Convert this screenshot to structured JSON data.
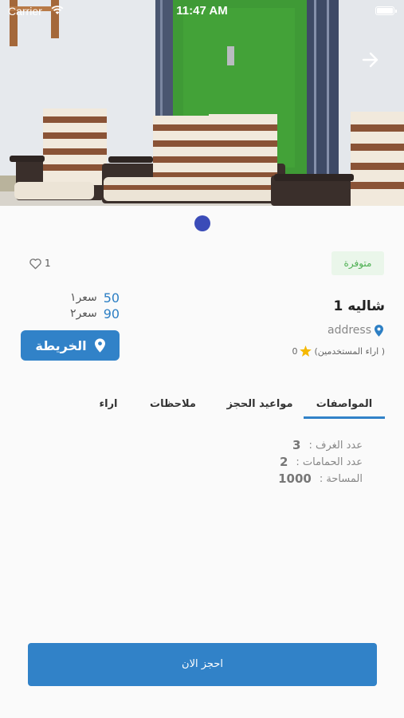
{
  "status_bar": {
    "carrier": "Carrier",
    "time": "11:47 AM"
  },
  "hero": {
    "page_count": 1,
    "current_page": 1
  },
  "listing": {
    "availability": "متوفرة",
    "favorites_count": "1",
    "title": "شاليه 1",
    "address": "address",
    "rating_value": "0",
    "reviews_label": "(اراء المستخدمين )",
    "prices": [
      {
        "label": "سعر١",
        "value": "50"
      },
      {
        "label": "سعر٢",
        "value": "90"
      }
    ],
    "map_button": "الخريطة"
  },
  "tabs": [
    {
      "label": "المواصفات",
      "active": true
    },
    {
      "label": "مواعيد الحجز",
      "active": false
    },
    {
      "label": "ملاحظات",
      "active": false
    },
    {
      "label": "اراء",
      "active": false
    }
  ],
  "specs": [
    {
      "label": "عدد الغرف :",
      "value": "3"
    },
    {
      "label": "عدد الحمامات :",
      "value": "2"
    },
    {
      "label": "المساحة :",
      "value": "1000"
    }
  ],
  "book_button": "احجز الان",
  "colors": {
    "primary": "#3182c8",
    "accent_blue": "#2d7fc4",
    "pager_dot": "#3b4cb8",
    "badge_text": "#4caf50",
    "star": "#f5b800"
  },
  "icons": {
    "back": "arrow-right-icon",
    "favorite": "heart-outline-icon",
    "location": "location-pin-icon",
    "star": "star-icon",
    "map": "location-pin-icon"
  }
}
